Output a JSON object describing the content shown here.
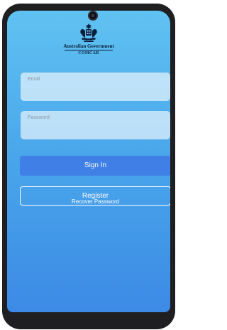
{
  "branding": {
    "crest_icon": "coat-of-arms-icon",
    "government": "Australian Government",
    "agency": "COMCAR"
  },
  "form": {
    "email_label": "Email",
    "email_value": "",
    "password_label": "Password",
    "password_value": ""
  },
  "actions": {
    "sign_in": "Sign In",
    "register": "Register",
    "recover": "Recover Password"
  },
  "colors": {
    "background_top": "#60c2f1",
    "background_bottom": "#3c8ae5",
    "primary_button": "#3f7fe6",
    "device_frame": "#1f1f22"
  }
}
